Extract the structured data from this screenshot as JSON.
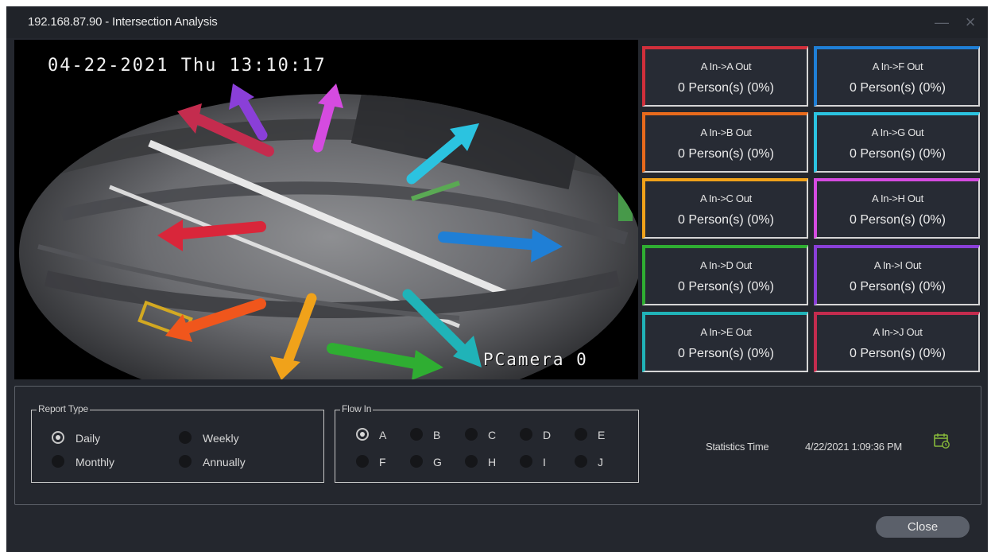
{
  "window": {
    "title": "192.168.87.90 - Intersection Analysis",
    "minimize_glyph": "—",
    "close_glyph": "×"
  },
  "camera": {
    "osd_timestamp": "04-22-2021 Thu 13:10:17",
    "osd_camera_name": "PCamera 0"
  },
  "tiles": [
    {
      "label": "A   In->A Out",
      "count": "0 Person(s) (0%)",
      "color": "#d12f3b"
    },
    {
      "label": "A   In->F Out",
      "count": "0 Person(s) (0%)",
      "color": "#1f7fd6"
    },
    {
      "label": "A   In->B Out",
      "count": "0 Person(s) (0%)",
      "color": "#e86a1c"
    },
    {
      "label": "A   In->G Out",
      "count": "0 Person(s) (0%)",
      "color": "#2bc3e0"
    },
    {
      "label": "A   In->C Out",
      "count": "0 Person(s) (0%)",
      "color": "#f0a21a"
    },
    {
      "label": "A   In->H Out",
      "count": "0 Person(s) (0%)",
      "color": "#d54be0"
    },
    {
      "label": "A   In->D Out",
      "count": "0 Person(s) (0%)",
      "color": "#2fae32"
    },
    {
      "label": "A   In->I Out",
      "count": "0 Person(s) (0%)",
      "color": "#8a3fd8"
    },
    {
      "label": "A   In->E Out",
      "count": "0 Person(s) (0%)",
      "color": "#20b3b8"
    },
    {
      "label": "A   In->J Out",
      "count": "0 Person(s) (0%)",
      "color": "#c42c4e"
    }
  ],
  "report_type": {
    "title": "Report Type",
    "options": [
      "Daily",
      "Weekly",
      "Monthly",
      "Annually"
    ],
    "selected": "Daily"
  },
  "flow_in": {
    "title": "Flow In",
    "options": [
      "A",
      "B",
      "C",
      "D",
      "E",
      "F",
      "G",
      "H",
      "I",
      "J"
    ],
    "selected": "A"
  },
  "statistics": {
    "label": "Statistics Time",
    "value": "4/22/2021 1:09:36 PM",
    "icon": "calendar-icon",
    "icon_color": "#86b83a"
  },
  "buttons": {
    "close": "Close"
  }
}
